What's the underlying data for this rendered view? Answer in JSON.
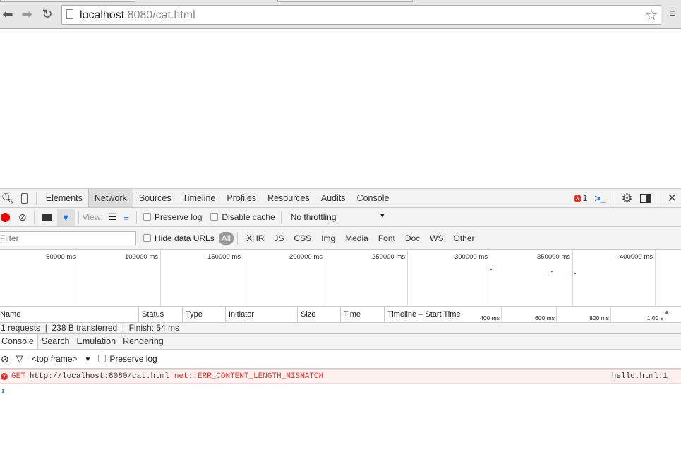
{
  "browser": {
    "url_host": "localhost",
    "url_rest": ":8080/cat.html"
  },
  "devtools": {
    "tabs": [
      "Elements",
      "Network",
      "Sources",
      "Timeline",
      "Profiles",
      "Resources",
      "Audits",
      "Console"
    ],
    "selected_tab": "Network",
    "error_count": "1"
  },
  "network": {
    "view_label": "View:",
    "preserve_log": "Preserve log",
    "disable_cache": "Disable cache",
    "throttling": "No throttling",
    "filter_placeholder": "Filter",
    "hide_data_urls": "Hide data URLs",
    "types": [
      "All",
      "XHR",
      "JS",
      "CSS",
      "Img",
      "Media",
      "Font",
      "Doc",
      "WS",
      "Other"
    ],
    "overview_ticks": [
      "50000 ms",
      "100000 ms",
      "150000 ms",
      "200000 ms",
      "250000 ms",
      "300000 ms",
      "350000 ms",
      "400000 ms"
    ],
    "columns": [
      "Name",
      "Status",
      "Type",
      "Initiator",
      "Size",
      "Time",
      "Timeline – Start Time"
    ],
    "timeline_ticks": [
      "400 ms",
      "600 ms",
      "800 ms",
      "1.00 s"
    ],
    "summary": {
      "requests": "1 requests",
      "transferred": "238 B transferred",
      "finish": "Finish: 54 ms"
    }
  },
  "drawer": {
    "tabs": [
      "Console",
      "Search",
      "Emulation",
      "Rendering"
    ],
    "context": "<top frame>",
    "preserve_log": "Preserve log",
    "error": {
      "method": "GET",
      "url": "http://localhost:8080/cat.html",
      "message": "net::ERR_CONTENT_LENGTH_MISMATCH",
      "source": "hello.html:1"
    },
    "prompt": "›"
  },
  "colors": {
    "error": "#e8332b",
    "accent": "#1a73e8",
    "error_bg": "#fff0f0"
  }
}
